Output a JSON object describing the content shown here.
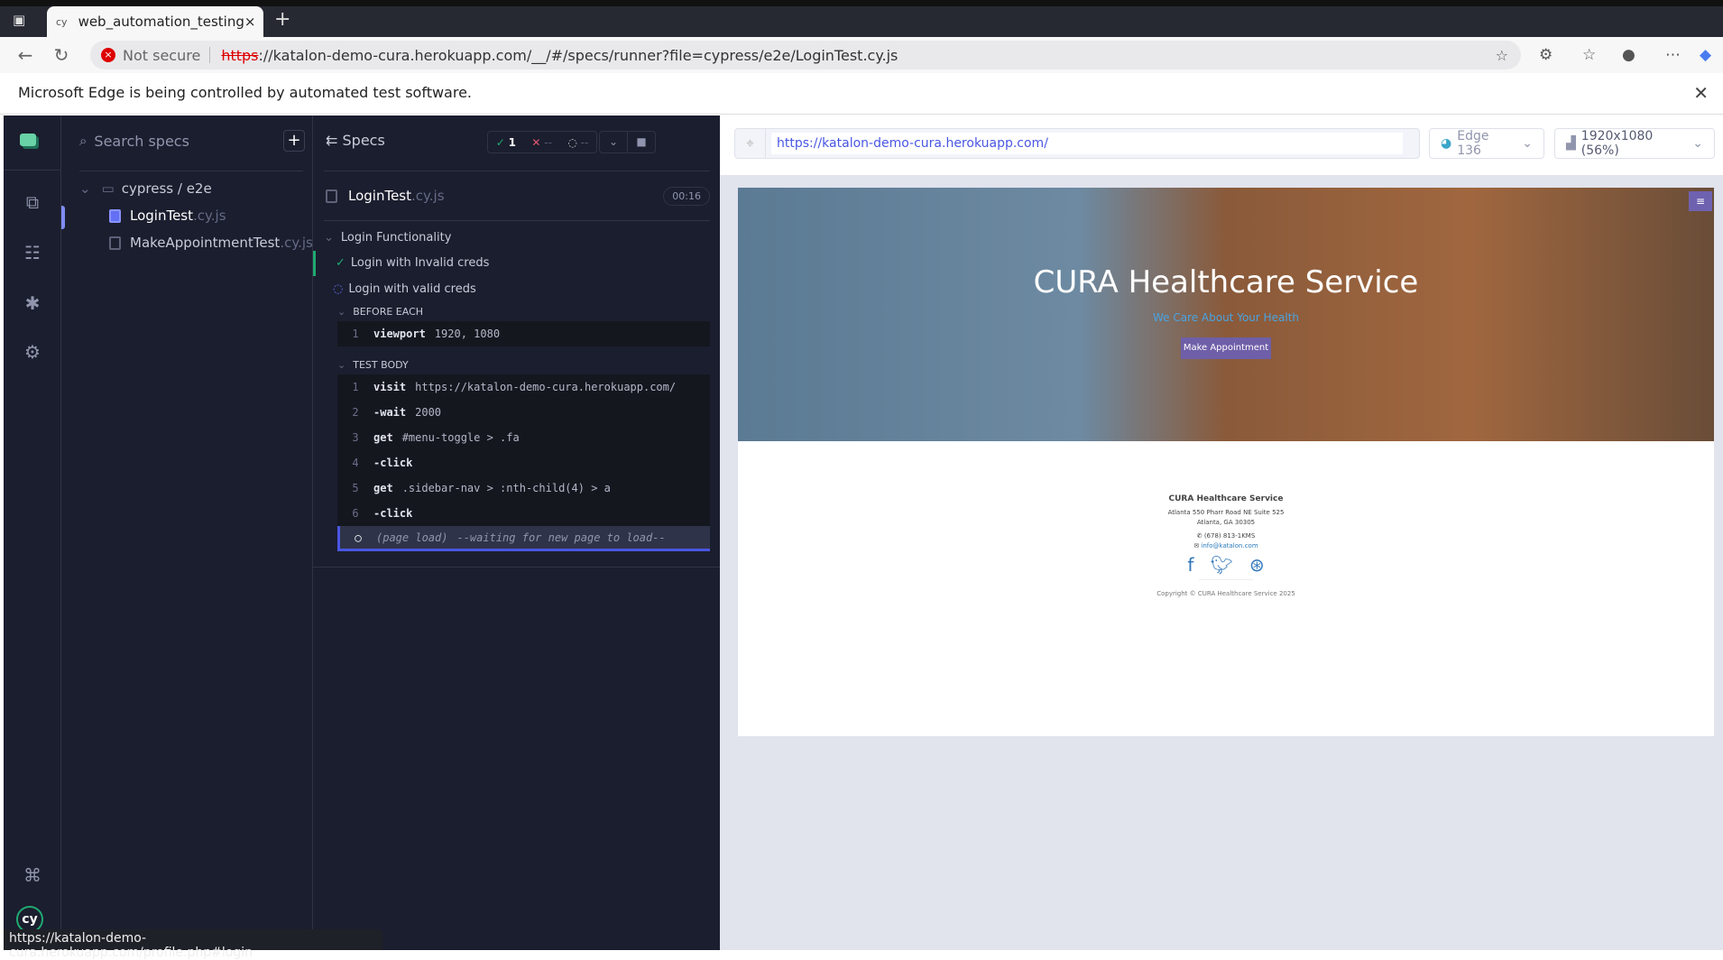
{
  "browser": {
    "tab_title": "web_automation_testing",
    "not_secure": "Not secure",
    "url_scheme": "https",
    "url_rest": "://katalon-demo-cura.herokuapp.com/__/#/specs/runner?file=cypress/e2e/LoginTest.cy.js",
    "info_bar": "Microsoft Edge is being controlled by automated test software.",
    "status_url": "https://katalon-demo-cura.herokuapp.com/profile.php#login"
  },
  "specs": {
    "search_placeholder": "Search specs",
    "folder": "cypress / e2e",
    "files": [
      {
        "name": "LoginTest",
        "ext": ".cy.js"
      },
      {
        "name": "MakeAppointmentTest",
        "ext": ".cy.js"
      }
    ]
  },
  "reporter": {
    "title": "Specs",
    "passed": "1",
    "failed": "--",
    "pending": "--",
    "file": "LoginTest",
    "file_ext": ".cy.js",
    "duration": "00:16",
    "suite": "Login Functionality",
    "tests": [
      {
        "title": "Login with Invalid creds",
        "state": "passed"
      },
      {
        "title": "Login with valid creds",
        "state": "running"
      }
    ],
    "before_each_label": "BEFORE EACH",
    "before_each": [
      {
        "n": "1",
        "cmd": "viewport",
        "arg": "1920, 1080"
      }
    ],
    "test_body_label": "TEST BODY",
    "body": [
      {
        "n": "1",
        "cmd": "visit",
        "arg": "https://katalon-demo-cura.herokuapp.com/"
      },
      {
        "n": "2",
        "cmd": "-wait",
        "arg": "2000"
      },
      {
        "n": "3",
        "cmd": "get",
        "arg": "#menu-toggle > .fa"
      },
      {
        "n": "4",
        "cmd": "-click",
        "arg": ""
      },
      {
        "n": "5",
        "cmd": "get",
        "arg": ".sidebar-nav > :nth-child(4) > a"
      },
      {
        "n": "6",
        "cmd": "-click",
        "arg": ""
      }
    ],
    "pending_cmd": "(page load)",
    "pending_arg": "--waiting for new page to load--"
  },
  "aut": {
    "url": "https://katalon-demo-cura.herokuapp.com/",
    "browser": "Edge 136",
    "viewport": "1920x1080 (56%)"
  },
  "site": {
    "title": "CURA Healthcare Service",
    "subtitle": "We Care About Your Health",
    "button": "Make Appointment",
    "footer_title": "CURA Healthcare Service",
    "address1": "Atlanta 550 Pharr Road NE Suite 525",
    "address2": "Atlanta, GA 30305",
    "phone": "(678) 813-1KMS",
    "email": "info@katalon.com",
    "copyright": "Copyright © CURA Healthcare Service 2025"
  }
}
